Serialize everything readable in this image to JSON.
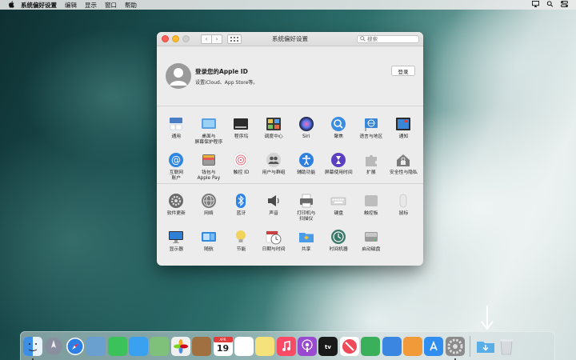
{
  "menubar": {
    "app_name": "系统偏好设置",
    "items": [
      "编辑",
      "显示",
      "窗口",
      "帮助"
    ]
  },
  "window": {
    "title": "系统偏好设置",
    "search_placeholder": "搜索",
    "nav_back": "‹",
    "nav_forward": "›"
  },
  "account": {
    "title": "登录您的Apple ID",
    "subtitle": "设置iCloud、App Store等。",
    "login_label": "登录"
  },
  "section1": [
    {
      "name": "general",
      "label": "通用",
      "icon": "general-icon",
      "color": "#4a7dc4"
    },
    {
      "name": "desktop-screensaver",
      "label": "桌面与\n屏幕保护程序",
      "icon": "desktop-icon",
      "color": "#5aa0e6"
    },
    {
      "name": "dock",
      "label": "程序坞",
      "icon": "dock-icon",
      "color": "#2b2b2b"
    },
    {
      "name": "mission-control",
      "label": "调度中心",
      "icon": "mission-control-icon",
      "color": "#3a3a3a"
    },
    {
      "name": "siri",
      "label": "Siri",
      "icon": "siri-icon",
      "color": "#5a3fd0"
    },
    {
      "name": "spotlight",
      "label": "聚焦",
      "icon": "spotlight-icon",
      "color": "#3a8de0"
    },
    {
      "name": "language-region",
      "label": "语言与地区",
      "icon": "flag-icon",
      "color": "#3a86d6"
    },
    {
      "name": "notifications",
      "label": "通知",
      "icon": "notifications-icon",
      "color": "#d64242"
    },
    {
      "name": "internet-accounts",
      "label": "互联网\n账户",
      "icon": "at-icon",
      "color": "#2f86e0"
    },
    {
      "name": "wallet-applepay",
      "label": "钱包与\nApple Pay",
      "icon": "wallet-icon",
      "color": "#6c6c6c"
    },
    {
      "name": "touch-id",
      "label": "触控 ID",
      "icon": "fingerprint-icon",
      "color": "#e26c7c"
    },
    {
      "name": "users-groups",
      "label": "用户与群组",
      "icon": "users-icon",
      "color": "#8a8a8a"
    },
    {
      "name": "accessibility",
      "label": "辅助功能",
      "icon": "accessibility-icon",
      "color": "#2f7fe0"
    },
    {
      "name": "screen-time",
      "label": "屏幕使用时间",
      "icon": "hourglass-icon",
      "color": "#5b3fbf"
    },
    {
      "name": "extensions",
      "label": "扩展",
      "icon": "puzzle-icon",
      "color": "#b9b9b9"
    },
    {
      "name": "security-privacy",
      "label": "安全性与隐私",
      "icon": "house-lock-icon",
      "color": "#7a7a7a"
    }
  ],
  "section2": [
    {
      "name": "software-update",
      "label": "软件更新",
      "icon": "gear-icon",
      "color": "#6a6a6a"
    },
    {
      "name": "network",
      "label": "网络",
      "icon": "globe-icon",
      "color": "#7a7a7a"
    },
    {
      "name": "bluetooth",
      "label": "蓝牙",
      "icon": "bluetooth-icon",
      "color": "#2d84e6"
    },
    {
      "name": "sound",
      "label": "声音",
      "icon": "speaker-icon",
      "color": "#4a4a4a"
    },
    {
      "name": "printers-scanners",
      "label": "打印机与\n扫描仪",
      "icon": "printer-icon",
      "color": "#6a6a6a"
    },
    {
      "name": "keyboard",
      "label": "键盘",
      "icon": "keyboard-icon",
      "color": "#d8d8d8"
    },
    {
      "name": "trackpad",
      "label": "触控板",
      "icon": "trackpad-icon",
      "color": "#bdbdbd"
    },
    {
      "name": "mouse",
      "label": "鼠标",
      "icon": "mouse-icon",
      "color": "#e8e8e8"
    },
    {
      "name": "displays",
      "label": "显示器",
      "icon": "display-icon",
      "color": "#2f7fd6"
    },
    {
      "name": "sidecar",
      "label": "随航",
      "icon": "sidecar-icon",
      "color": "#2f8ae0"
    },
    {
      "name": "energy-saver",
      "label": "节能",
      "icon": "lightbulb-icon",
      "color": "#f2d35a"
    },
    {
      "name": "date-time",
      "label": "日期与时间",
      "icon": "clock-calendar-icon",
      "color": "#c94040"
    },
    {
      "name": "sharing",
      "label": "共享",
      "icon": "sharing-folder-icon",
      "color": "#4a9be8"
    },
    {
      "name": "time-machine",
      "label": "时间机器",
      "icon": "time-machine-icon",
      "color": "#3b7a6a"
    },
    {
      "name": "startup-disk",
      "label": "启动磁盘",
      "icon": "disk-icon",
      "color": "#9a9a9a"
    }
  ],
  "dock_apps": [
    {
      "name": "finder",
      "color": "#3d8fe6",
      "running": true
    },
    {
      "name": "launchpad",
      "color": "#8a8fa0",
      "running": false
    },
    {
      "name": "safari",
      "color": "#2d7fe6",
      "running": false
    },
    {
      "name": "preview",
      "color": "#6aa0d0",
      "running": false
    },
    {
      "name": "facetime",
      "color": "#3cc25a",
      "running": false
    },
    {
      "name": "messages",
      "color": "#3aa0f0",
      "running": false
    },
    {
      "name": "maps",
      "color": "#7fc07a",
      "running": false
    },
    {
      "name": "photos",
      "color": "#f0f0f0",
      "running": false
    },
    {
      "name": "notebook",
      "color": "#a07040",
      "running": false
    },
    {
      "name": "calendar",
      "color": "#ffffff",
      "running": false
    },
    {
      "name": "reminders",
      "color": "#ffffff",
      "running": false
    },
    {
      "name": "notes",
      "color": "#f5e27a",
      "running": false
    },
    {
      "name": "music",
      "color": "#fa4a66",
      "running": false
    },
    {
      "name": "podcasts",
      "color": "#9a4ad0",
      "running": false
    },
    {
      "name": "apple-tv",
      "color": "#1a1a1a",
      "running": false
    },
    {
      "name": "news",
      "color": "#f04a5a",
      "running": false
    },
    {
      "name": "numbers",
      "color": "#3ab05a",
      "running": false
    },
    {
      "name": "keynote",
      "color": "#3a86e0",
      "running": false
    },
    {
      "name": "pages",
      "color": "#f09a3a",
      "running": false
    },
    {
      "name": "app-store",
      "color": "#2f8ef0",
      "running": false
    },
    {
      "name": "system-preferences",
      "color": "#7a7a7a",
      "running": true
    }
  ],
  "dock_right": [
    {
      "name": "downloads-folder",
      "color": "#5aaee8"
    },
    {
      "name": "trash",
      "color": "#d6dadc"
    }
  ],
  "calendar_day": "19",
  "calendar_month": "APR"
}
